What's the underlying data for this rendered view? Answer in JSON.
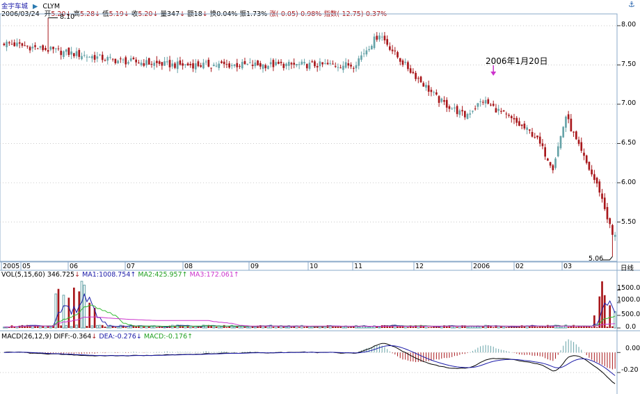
{
  "header": {
    "stock_name": "金宇车城",
    "code": "CLYM",
    "date": "2006/03/24",
    "open_label": "开",
    "open_value": "5.20",
    "high_label": "高",
    "high_value": "5.28",
    "low_label": "低",
    "low_value": "5.19",
    "close_label": "收",
    "close_value": "5.20",
    "vol_label": "量",
    "vol_value": "347",
    "amt_label": "额",
    "amt_value": "18",
    "turnover_label": "换",
    "turnover_value": "0.04%",
    "amp_label": "振",
    "amp_value": "1.73%",
    "change_label": "涨",
    "change_value": "(-0.05)-0.98%",
    "index_label": "指数",
    "index_value": "(-12.75)-0.37%"
  },
  "colors": {
    "up": "#66a3a8",
    "down": "#a8171b",
    "ma1": "#1a1aa8",
    "ma2": "#33bb33",
    "ma3": "#cc33cc",
    "diff": "#000000",
    "dea": "#1a1aa8",
    "grid": "#c8c8c8",
    "annotation_arrow": "#cc33cc"
  },
  "annotation": {
    "text": "2006年1月20日"
  },
  "dates_row": {
    "labels": [
      "2005",
      "05",
      "06",
      "07",
      "08",
      "09",
      "10",
      "11",
      "12",
      "2006",
      "02",
      "03"
    ],
    "right_button": "日线"
  },
  "vol_header": {
    "name": "VOL(5,15,60)",
    "vol": "346.725",
    "ma1_label": "MA1:",
    "ma1": "1008.754",
    "ma2_label": "MA2:",
    "ma2": "425.957",
    "ma3_label": "MA3:",
    "ma3": "172.061"
  },
  "macd_header": {
    "name": "MACD(26,12,9)",
    "diff_label": "DIFF:",
    "diff": "-0.364",
    "dea_label": "DEA:",
    "dea": "-0.276",
    "macd_label": "MACD:",
    "macd": "-0.176"
  },
  "chart_data": [
    {
      "type": "candlestick",
      "title": "金宇车城 CLYM",
      "yticks": [
        "8.00",
        "7.50",
        "7.00",
        "6.50",
        "6.00",
        "5.50"
      ],
      "ylim": [
        5.0,
        8.15
      ],
      "max_marker": "8.10",
      "min_marker": "5.06",
      "x": [
        "2005",
        "05",
        "06",
        "07",
        "08",
        "09",
        "10",
        "11",
        "12",
        "2006",
        "02",
        "03"
      ],
      "segments": [
        {
          "from": 0,
          "to": 45,
          "start": 7.78,
          "end": 7.55
        },
        {
          "from": 45,
          "to": 65,
          "start": 7.55,
          "end": 7.5
        },
        {
          "from": 65,
          "to": 135,
          "start": 7.5,
          "end": 7.5
        },
        {
          "from": 135,
          "to": 145,
          "start": 7.5,
          "end": 7.9
        },
        {
          "from": 145,
          "to": 152,
          "start": 7.9,
          "end": 7.6
        },
        {
          "from": 152,
          "to": 168,
          "start": 7.6,
          "end": 7.05
        },
        {
          "from": 168,
          "to": 178,
          "start": 7.05,
          "end": 6.85
        },
        {
          "from": 178,
          "to": 185,
          "start": 6.85,
          "end": 7.05
        },
        {
          "from": 185,
          "to": 205,
          "start": 7.05,
          "end": 6.6
        },
        {
          "from": 205,
          "to": 212,
          "start": 6.6,
          "end": 6.2
        },
        {
          "from": 212,
          "to": 217,
          "start": 6.2,
          "end": 6.85
        },
        {
          "from": 217,
          "to": 222,
          "start": 6.85,
          "end": 6.45
        },
        {
          "from": 222,
          "to": 230,
          "start": 6.45,
          "end": 5.9
        },
        {
          "from": 230,
          "to": 236,
          "start": 5.9,
          "end": 5.22
        }
      ],
      "markers": {
        "max_at": 17,
        "max_value": 8.1,
        "min_at": 235,
        "min_value": 5.06,
        "annotated_at": 189
      }
    },
    {
      "type": "bar",
      "title": "VOL(5,15,60)",
      "yticks": [
        "1500.0",
        "1000.0",
        "500.0",
        "0.0"
      ],
      "ylim": [
        0,
        1900
      ],
      "series": [
        {
          "name": "VOL",
          "values_note": "daily volume bars"
        },
        {
          "name": "MA1",
          "value": 1008.754
        },
        {
          "name": "MA2",
          "value": 425.957
        },
        {
          "name": "MA3",
          "value": 172.061
        }
      ],
      "spikes": [
        {
          "at": 20,
          "value": 1350
        },
        {
          "at": 21,
          "value": 1550
        },
        {
          "at": 23,
          "value": 1300
        },
        {
          "at": 25,
          "value": 1200
        },
        {
          "at": 27,
          "value": 1600
        },
        {
          "at": 29,
          "value": 1450
        },
        {
          "at": 30,
          "value": 1850
        },
        {
          "at": 31,
          "value": 1700
        },
        {
          "at": 33,
          "value": 1000
        },
        {
          "at": 35,
          "value": 800
        },
        {
          "at": 228,
          "value": 500
        },
        {
          "at": 230,
          "value": 1250
        },
        {
          "at": 231,
          "value": 1850
        },
        {
          "at": 232,
          "value": 1300
        },
        {
          "at": 234,
          "value": 900
        },
        {
          "at": 236,
          "value": 650
        }
      ]
    },
    {
      "type": "bar",
      "title": "MACD(26,12,9)",
      "yticks": [
        "0.00",
        "-0.20"
      ],
      "ylim": [
        -0.38,
        0.12
      ],
      "series": [
        {
          "name": "DIFF",
          "value": -0.364
        },
        {
          "name": "DEA",
          "value": -0.276
        },
        {
          "name": "MACD",
          "value": -0.176
        }
      ]
    }
  ]
}
